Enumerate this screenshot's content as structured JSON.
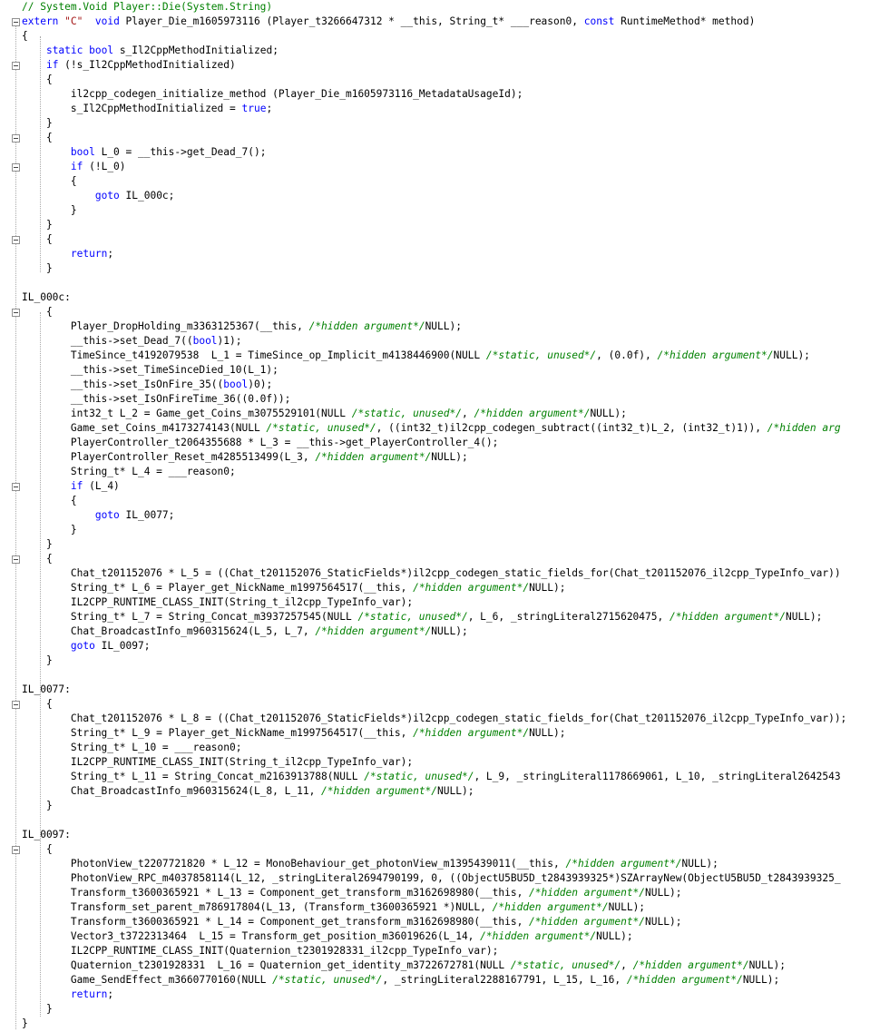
{
  "editor": {
    "language": "C++",
    "colors": {
      "keyword": "#0000ff",
      "comment": "#008000",
      "string": "#a31515",
      "text": "#000000",
      "background": "#ffffff"
    },
    "lines": [
      [
        [
          "cm-top",
          "// System.Void Player::Die(System.String)"
        ]
      ],
      [
        [
          "kw",
          "extern "
        ],
        [
          "str",
          "\"C\""
        ],
        [
          "",
          "  "
        ],
        [
          "kw",
          "void"
        ],
        [
          "",
          " Player_Die_m1605973116 (Player_t3266647312 * __this, String_t* ___reason0, "
        ],
        [
          "kw",
          "const"
        ],
        [
          "",
          " RuntimeMethod* method)"
        ]
      ],
      [
        [
          "",
          "{"
        ]
      ],
      [
        [
          "",
          "    "
        ],
        [
          "kw",
          "static"
        ],
        [
          "",
          " "
        ],
        [
          "kw",
          "bool"
        ],
        [
          "",
          " s_Il2CppMethodInitialized;"
        ]
      ],
      [
        [
          "",
          "    "
        ],
        [
          "kw",
          "if"
        ],
        [
          "",
          " (!s_Il2CppMethodInitialized)"
        ]
      ],
      [
        [
          "",
          "    {"
        ]
      ],
      [
        [
          "",
          "        il2cpp_codegen_initialize_method (Player_Die_m1605973116_MetadataUsageId);"
        ]
      ],
      [
        [
          "",
          "        s_Il2CppMethodInitialized = "
        ],
        [
          "kw",
          "true"
        ],
        [
          "",
          ";"
        ]
      ],
      [
        [
          "",
          "    }"
        ]
      ],
      [
        [
          "",
          "    {"
        ]
      ],
      [
        [
          "",
          "        "
        ],
        [
          "kw",
          "bool"
        ],
        [
          "",
          " L_0 = __this->get_Dead_7();"
        ]
      ],
      [
        [
          "",
          "        "
        ],
        [
          "kw",
          "if"
        ],
        [
          "",
          " (!L_0)"
        ]
      ],
      [
        [
          "",
          "        {"
        ]
      ],
      [
        [
          "",
          "            "
        ],
        [
          "kw",
          "goto"
        ],
        [
          "",
          " IL_000c;"
        ]
      ],
      [
        [
          "",
          "        }"
        ]
      ],
      [
        [
          "",
          "    }"
        ]
      ],
      [
        [
          "",
          "    {"
        ]
      ],
      [
        [
          "",
          "        "
        ],
        [
          "kw",
          "return"
        ],
        [
          "",
          ";"
        ]
      ],
      [
        [
          "",
          "    }"
        ]
      ],
      [
        [
          "",
          ""
        ]
      ],
      [
        [
          "",
          "IL_000c:"
        ]
      ],
      [
        [
          "",
          "    {"
        ]
      ],
      [
        [
          "",
          "        Player_DropHolding_m3363125367(__this, "
        ],
        [
          "cm",
          "/*hidden argument*/"
        ],
        [
          "",
          "NULL);"
        ]
      ],
      [
        [
          "",
          "        __this->set_Dead_7(("
        ],
        [
          "kw",
          "bool"
        ],
        [
          "",
          ")1);"
        ]
      ],
      [
        [
          "",
          "        TimeSince_t4192079538  L_1 = TimeSince_op_Implicit_m4138446900(NULL "
        ],
        [
          "cm",
          "/*static, unused*/"
        ],
        [
          "",
          ", (0.0f), "
        ],
        [
          "cm",
          "/*hidden argument*/"
        ],
        [
          "",
          "NULL);"
        ]
      ],
      [
        [
          "",
          "        __this->set_TimeSinceDied_10(L_1);"
        ]
      ],
      [
        [
          "",
          "        __this->set_IsOnFire_35(("
        ],
        [
          "kw",
          "bool"
        ],
        [
          "",
          ")0);"
        ]
      ],
      [
        [
          "",
          "        __this->set_IsOnFireTime_36((0.0f));"
        ]
      ],
      [
        [
          "",
          "        int32_t L_2 = Game_get_Coins_m3075529101(NULL "
        ],
        [
          "cm",
          "/*static, unused*/"
        ],
        [
          "",
          ", "
        ],
        [
          "cm",
          "/*hidden argument*/"
        ],
        [
          "",
          "NULL);"
        ]
      ],
      [
        [
          "",
          "        Game_set_Coins_m4173274143(NULL "
        ],
        [
          "cm",
          "/*static, unused*/"
        ],
        [
          "",
          ", ((int32_t)il2cpp_codegen_subtract((int32_t)L_2, (int32_t)1)), "
        ],
        [
          "cm",
          "/*hidden arg"
        ]
      ],
      [
        [
          "",
          "        PlayerController_t2064355688 * L_3 = __this->get_PlayerController_4();"
        ]
      ],
      [
        [
          "",
          "        PlayerController_Reset_m4285513499(L_3, "
        ],
        [
          "cm",
          "/*hidden argument*/"
        ],
        [
          "",
          "NULL);"
        ]
      ],
      [
        [
          "",
          "        String_t* L_4 = ___reason0;"
        ]
      ],
      [
        [
          "",
          "        "
        ],
        [
          "kw",
          "if"
        ],
        [
          "",
          " (L_4)"
        ]
      ],
      [
        [
          "",
          "        {"
        ]
      ],
      [
        [
          "",
          "            "
        ],
        [
          "kw",
          "goto"
        ],
        [
          "",
          " IL_0077;"
        ]
      ],
      [
        [
          "",
          "        }"
        ]
      ],
      [
        [
          "",
          "    }"
        ]
      ],
      [
        [
          "",
          "    {"
        ]
      ],
      [
        [
          "",
          "        Chat_t201152076 * L_5 = ((Chat_t201152076_StaticFields*)il2cpp_codegen_static_fields_for(Chat_t201152076_il2cpp_TypeInfo_var))"
        ]
      ],
      [
        [
          "",
          "        String_t* L_6 = Player_get_NickName_m1997564517(__this, "
        ],
        [
          "cm",
          "/*hidden argument*/"
        ],
        [
          "",
          "NULL);"
        ]
      ],
      [
        [
          "",
          "        IL2CPP_RUNTIME_CLASS_INIT(String_t_il2cpp_TypeInfo_var);"
        ]
      ],
      [
        [
          "",
          "        String_t* L_7 = String_Concat_m3937257545(NULL "
        ],
        [
          "cm",
          "/*static, unused*/"
        ],
        [
          "",
          ", L_6, _stringLiteral2715620475, "
        ],
        [
          "cm",
          "/*hidden argument*/"
        ],
        [
          "",
          "NULL);"
        ]
      ],
      [
        [
          "",
          "        Chat_BroadcastInfo_m960315624(L_5, L_7, "
        ],
        [
          "cm",
          "/*hidden argument*/"
        ],
        [
          "",
          "NULL);"
        ]
      ],
      [
        [
          "",
          "        "
        ],
        [
          "kw",
          "goto"
        ],
        [
          "",
          " IL_0097;"
        ]
      ],
      [
        [
          "",
          "    }"
        ]
      ],
      [
        [
          "",
          ""
        ]
      ],
      [
        [
          "",
          "IL_0077:"
        ]
      ],
      [
        [
          "",
          "    {"
        ]
      ],
      [
        [
          "",
          "        Chat_t201152076 * L_8 = ((Chat_t201152076_StaticFields*)il2cpp_codegen_static_fields_for(Chat_t201152076_il2cpp_TypeInfo_var));"
        ]
      ],
      [
        [
          "",
          "        String_t* L_9 = Player_get_NickName_m1997564517(__this, "
        ],
        [
          "cm",
          "/*hidden argument*/"
        ],
        [
          "",
          "NULL);"
        ]
      ],
      [
        [
          "",
          "        String_t* L_10 = ___reason0;"
        ]
      ],
      [
        [
          "",
          "        IL2CPP_RUNTIME_CLASS_INIT(String_t_il2cpp_TypeInfo_var);"
        ]
      ],
      [
        [
          "",
          "        String_t* L_11 = String_Concat_m2163913788(NULL "
        ],
        [
          "cm",
          "/*static, unused*/"
        ],
        [
          "",
          ", L_9, _stringLiteral1178669061, L_10, _stringLiteral2642543"
        ]
      ],
      [
        [
          "",
          "        Chat_BroadcastInfo_m960315624(L_8, L_11, "
        ],
        [
          "cm",
          "/*hidden argument*/"
        ],
        [
          "",
          "NULL);"
        ]
      ],
      [
        [
          "",
          "    }"
        ]
      ],
      [
        [
          "",
          ""
        ]
      ],
      [
        [
          "",
          "IL_0097:"
        ]
      ],
      [
        [
          "",
          "    {"
        ]
      ],
      [
        [
          "",
          "        PhotonView_t2207721820 * L_12 = MonoBehaviour_get_photonView_m1395439011(__this, "
        ],
        [
          "cm",
          "/*hidden argument*/"
        ],
        [
          "",
          "NULL);"
        ]
      ],
      [
        [
          "",
          "        PhotonView_RPC_m4037858114(L_12, _stringLiteral2694790199, 0, ((ObjectU5BU5D_t2843939325*)SZArrayNew(ObjectU5BU5D_t2843939325_"
        ]
      ],
      [
        [
          "",
          "        Transform_t3600365921 * L_13 = Component_get_transform_m3162698980(__this, "
        ],
        [
          "cm",
          "/*hidden argument*/"
        ],
        [
          "",
          "NULL);"
        ]
      ],
      [
        [
          "",
          "        Transform_set_parent_m786917804(L_13, (Transform_t3600365921 *)NULL, "
        ],
        [
          "cm",
          "/*hidden argument*/"
        ],
        [
          "",
          "NULL);"
        ]
      ],
      [
        [
          "",
          "        Transform_t3600365921 * L_14 = Component_get_transform_m3162698980(__this, "
        ],
        [
          "cm",
          "/*hidden argument*/"
        ],
        [
          "",
          "NULL);"
        ]
      ],
      [
        [
          "",
          "        Vector3_t3722313464  L_15 = Transform_get_position_m36019626(L_14, "
        ],
        [
          "cm",
          "/*hidden argument*/"
        ],
        [
          "",
          "NULL);"
        ]
      ],
      [
        [
          "",
          "        IL2CPP_RUNTIME_CLASS_INIT(Quaternion_t2301928331_il2cpp_TypeInfo_var);"
        ]
      ],
      [
        [
          "",
          "        Quaternion_t2301928331  L_16 = Quaternion_get_identity_m3722672781(NULL "
        ],
        [
          "cm",
          "/*static, unused*/"
        ],
        [
          "",
          ", "
        ],
        [
          "cm",
          "/*hidden argument*/"
        ],
        [
          "",
          "NULL);"
        ]
      ],
      [
        [
          "",
          "        Game_SendEffect_m3660770160(NULL "
        ],
        [
          "cm",
          "/*static, unused*/"
        ],
        [
          "",
          ", _stringLiteral2288167791, L_15, L_16, "
        ],
        [
          "cm",
          "/*hidden argument*/"
        ],
        [
          "",
          "NULL);"
        ]
      ],
      [
        [
          "",
          "        "
        ],
        [
          "kw",
          "return"
        ],
        [
          "",
          ";"
        ]
      ],
      [
        [
          "",
          "    }"
        ]
      ],
      [
        [
          "",
          "}"
        ]
      ]
    ]
  }
}
